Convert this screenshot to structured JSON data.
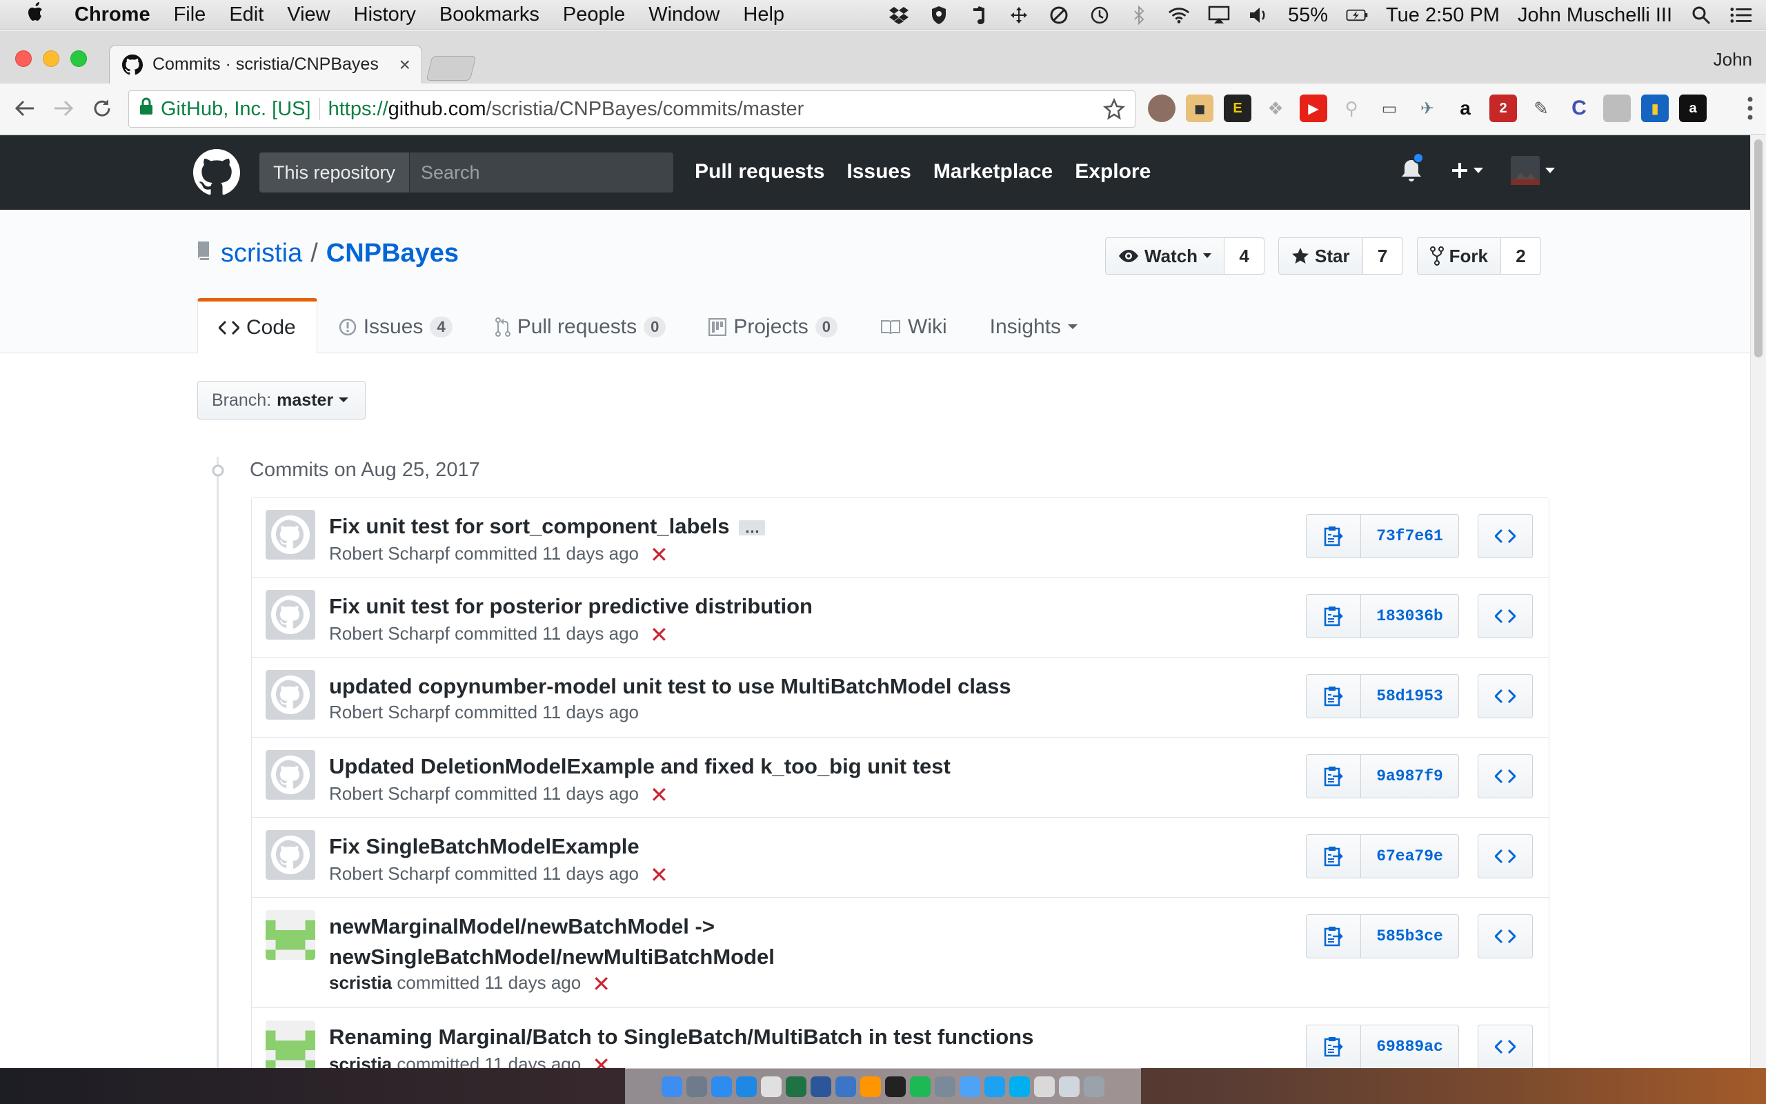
{
  "menubar": {
    "app": "Chrome",
    "items": [
      "File",
      "Edit",
      "View",
      "History",
      "Bookmarks",
      "People",
      "Window",
      "Help"
    ],
    "battery": "55%",
    "clock": "Tue 2:50 PM",
    "user": "John Muschelli III"
  },
  "browser": {
    "tab_title": "Commits · scristia/CNPBayes",
    "profile": "John",
    "secure_label": "GitHub, Inc. [US]",
    "url_scheme": "https://",
    "url_host": "github.com",
    "url_path": "/scristia/CNPBayes/commits/master"
  },
  "github": {
    "scope_label": "This repository",
    "search_placeholder": "Search",
    "nav": [
      "Pull requests",
      "Issues",
      "Marketplace",
      "Explore"
    ]
  },
  "repo": {
    "owner": "scristia",
    "separator": "/",
    "name": "CNPBayes",
    "watch_label": "Watch",
    "watch_count": "4",
    "star_label": "Star",
    "star_count": "7",
    "fork_label": "Fork",
    "fork_count": "2",
    "tabs": [
      {
        "label": "Code",
        "count": ""
      },
      {
        "label": "Issues",
        "count": "4"
      },
      {
        "label": "Pull requests",
        "count": "0"
      },
      {
        "label": "Projects",
        "count": "0"
      },
      {
        "label": "Wiki",
        "count": ""
      },
      {
        "label": "Insights",
        "count": ""
      }
    ]
  },
  "branch": {
    "prefix": "Branch:",
    "name": "master"
  },
  "commits_date": "Commits on Aug 25, 2017",
  "commits": [
    {
      "message": "Fix unit test for sort_component_labels",
      "author": "Robert Scharpf",
      "verb": "committed",
      "time": "11 days ago",
      "status": "✕",
      "sha": "73f7e61"
    },
    {
      "message": "Fix unit test for posterior predictive distribution",
      "author": "Robert Scharpf",
      "verb": "committed",
      "time": "11 days ago",
      "status": "✕",
      "sha": "183036b"
    },
    {
      "message": "updated copynumber-model unit test to use MultiBatchModel class",
      "author": "Robert Scharpf",
      "verb": "committed",
      "time": "11 days ago",
      "status": "",
      "sha": "58d1953"
    },
    {
      "message": "Updated DeletionModelExample and fixed k_too_big unit test",
      "author": "Robert Scharpf",
      "verb": "committed",
      "time": "11 days ago",
      "status": "✕",
      "sha": "9a987f9"
    },
    {
      "message": "Fix SingleBatchModelExample",
      "author": "Robert Scharpf",
      "verb": "committed",
      "time": "11 days ago",
      "status": "✕",
      "sha": "67ea79e"
    },
    {
      "message": "newMarginalModel/newBatchModel -> newSingleBatchModel/newMultiBatchModel",
      "author": "scristia",
      "verb": "committed",
      "time": "11 days ago",
      "status": "✕",
      "sha": "585b3ce"
    },
    {
      "message": "Renaming Marginal/Batch to SingleBatch/MultiBatch in test functions",
      "author": "scristia",
      "verb": "committed",
      "time": "11 days ago",
      "status": "✕",
      "sha": "69889ac"
    }
  ],
  "ellipsis_label": "…",
  "colors": {
    "gh_header": "#24292e",
    "link": "#0366d6",
    "fail": "#cb2431",
    "tab_accent": "#e36209"
  }
}
